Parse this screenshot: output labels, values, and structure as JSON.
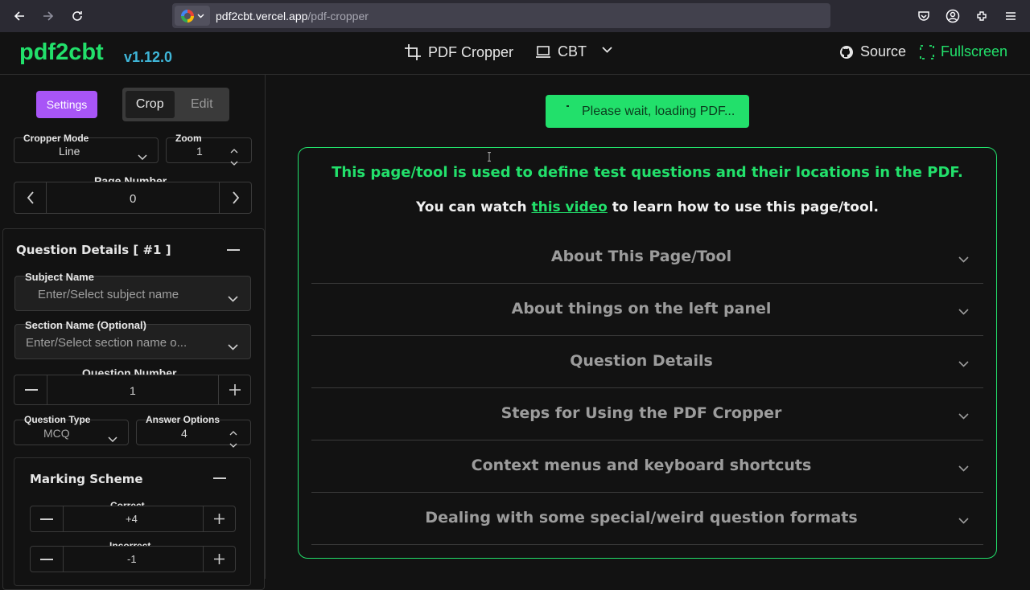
{
  "browser": {
    "url_host": "pdf2cbt.vercel.app",
    "url_path": "/pdf-cropper"
  },
  "header": {
    "brand": "pdf2cbt",
    "version": "v1.12.0",
    "nav_cropper": "PDF Cropper",
    "nav_cbt": "CBT",
    "source": "Source",
    "fullscreen": "Fullscreen",
    "accent": "#22e06b"
  },
  "left": {
    "settings_label": "Settings",
    "tabs": [
      "Crop",
      "Edit"
    ],
    "cropper_mode_label": "Cropper Mode",
    "cropper_mode_value": "Line",
    "zoom_label": "Zoom",
    "zoom_value": "1",
    "page_number_label": "Page Number",
    "page_number_value": "0",
    "question_details_title": "Question Details [ #1 ]",
    "subject_label": "Subject Name",
    "subject_placeholder": "Enter/Select subject name",
    "section_label": "Section Name (Optional)",
    "section_placeholder": "Enter/Select section name o...",
    "question_number_label": "Question Number",
    "question_number_value": "1",
    "question_type_label": "Question Type",
    "question_type_value": "MCQ",
    "answer_options_label": "Answer Options",
    "answer_options_value": "4",
    "marking_scheme_title": "Marking Scheme",
    "correct_label": "Correct",
    "correct_value": "+4",
    "incorrect_label": "Incorrect",
    "incorrect_value": "-1"
  },
  "main": {
    "toast": "Please wait, loading PDF...",
    "headline": "This page/tool is used to define test questions and their locations in the PDF.",
    "sub_before": "You can watch ",
    "sub_link": "this video",
    "sub_after": " to learn how to use this page/tool.",
    "accordions": [
      "About This Page/Tool",
      "About things on the left panel",
      "Question Details",
      "Steps for Using the PDF Cropper",
      "Context menus and keyboard shortcuts",
      "Dealing with some special/weird question formats"
    ]
  }
}
